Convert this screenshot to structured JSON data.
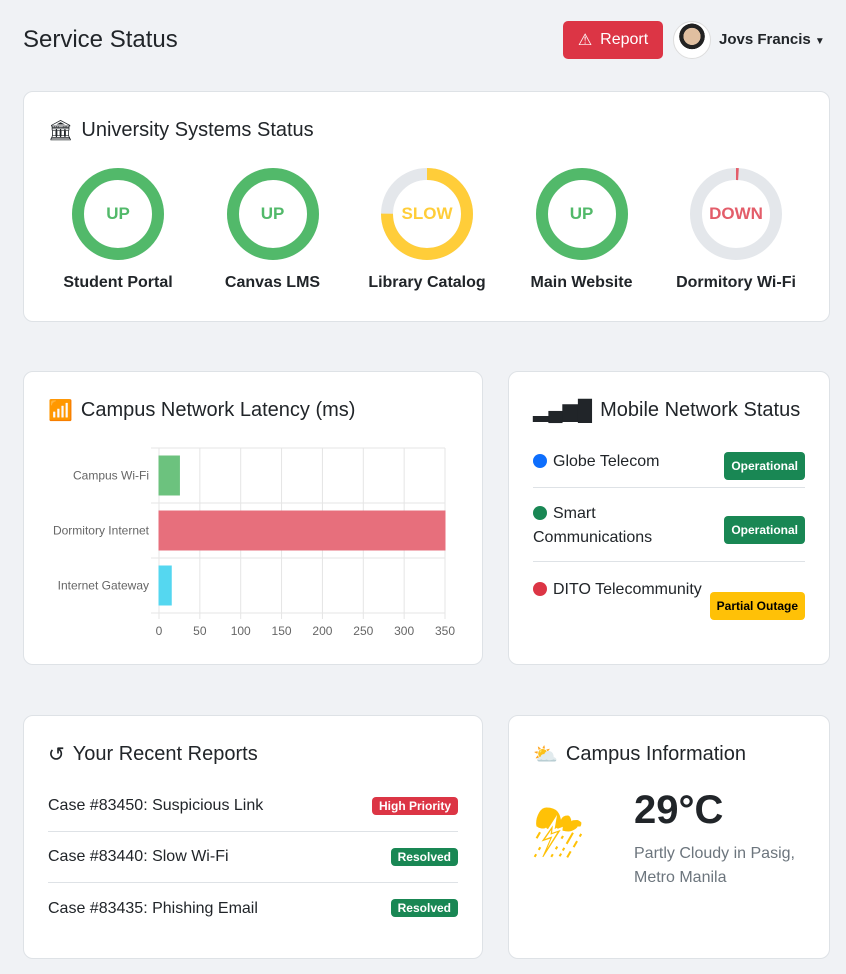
{
  "header": {
    "title": "Service Status",
    "report_label": "Report",
    "user_name": "Jovs Francis"
  },
  "systems": {
    "title": "University Systems Status",
    "items": [
      {
        "name": "Student Portal",
        "status": "UP",
        "percent": 100,
        "color": "#52b96a"
      },
      {
        "name": "Canvas LMS",
        "status": "UP",
        "percent": 100,
        "color": "#52b96a"
      },
      {
        "name": "Library Catalog",
        "status": "SLOW",
        "percent": 75,
        "color": "#ffcd39"
      },
      {
        "name": "Main Website",
        "status": "UP",
        "percent": 100,
        "color": "#52b96a"
      },
      {
        "name": "Dormitory Wi-Fi",
        "status": "DOWN",
        "percent": 1,
        "color": "#e35d6a"
      }
    ]
  },
  "latency": {
    "title": "Campus Network Latency (ms)"
  },
  "chart_data": {
    "type": "bar",
    "orientation": "horizontal",
    "title": "Campus Network Latency (ms)",
    "categories": [
      "Campus Wi-Fi",
      "Dormitory Internet",
      "Internet Gateway"
    ],
    "values": [
      25,
      350,
      15
    ],
    "colors": [
      "#6cc27e",
      "#e76f7c",
      "#55d7f0"
    ],
    "xlim": [
      0,
      350
    ],
    "xticks": [
      0,
      50,
      100,
      150,
      200,
      250,
      300,
      350
    ],
    "grid": true
  },
  "mobile": {
    "title": "Mobile Network Status",
    "items": [
      {
        "name": "Globe Telecom",
        "status": "Operational",
        "dot": "#0d6efd",
        "badge": "#198754"
      },
      {
        "name": "Smart Communications",
        "status": "Operational",
        "dot": "#198754",
        "badge": "#198754"
      },
      {
        "name": "DITO Telecommunity",
        "status": "Partial Outage",
        "dot": "#dc3545",
        "badge": "#ffc107"
      }
    ]
  },
  "reports": {
    "title": "Your Recent Reports",
    "items": [
      {
        "case": "Case #83450: Suspicious Link",
        "status": "High Priority",
        "color": "#dc3545"
      },
      {
        "case": "Case #83440: Slow Wi-Fi",
        "status": "Resolved",
        "color": "#198754"
      },
      {
        "case": "Case #83435: Phishing Email",
        "status": "Resolved",
        "color": "#198754"
      }
    ]
  },
  "campus": {
    "title": "Campus Information",
    "temp": "29°C",
    "desc": "Partly Cloudy in Pasig, Metro Manila"
  }
}
